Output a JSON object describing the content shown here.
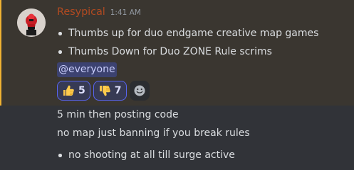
{
  "message": {
    "username": "Resypical",
    "username_color": "#b14a21",
    "timestamp": "1:41 AM",
    "bullets": [
      "Thumbs up for duo endgame creative map games",
      "Thumbs Down for Duo ZONE Rule scrims"
    ],
    "mention": "@everyone",
    "reactions": [
      {
        "emoji": "thumbs-up-icon",
        "count": "5"
      },
      {
        "emoji": "thumbs-down-icon",
        "count": "7"
      }
    ]
  },
  "followups": {
    "line1": "5 min then posting code",
    "line2": "no map just banning if you break rules",
    "bullets": [
      "no shooting at all till surge active"
    ]
  },
  "colors": {
    "background": "#313338",
    "mention_highlight": "#3a3630",
    "mention_bar": "#f0b232",
    "reaction_border": "#5865f2"
  }
}
